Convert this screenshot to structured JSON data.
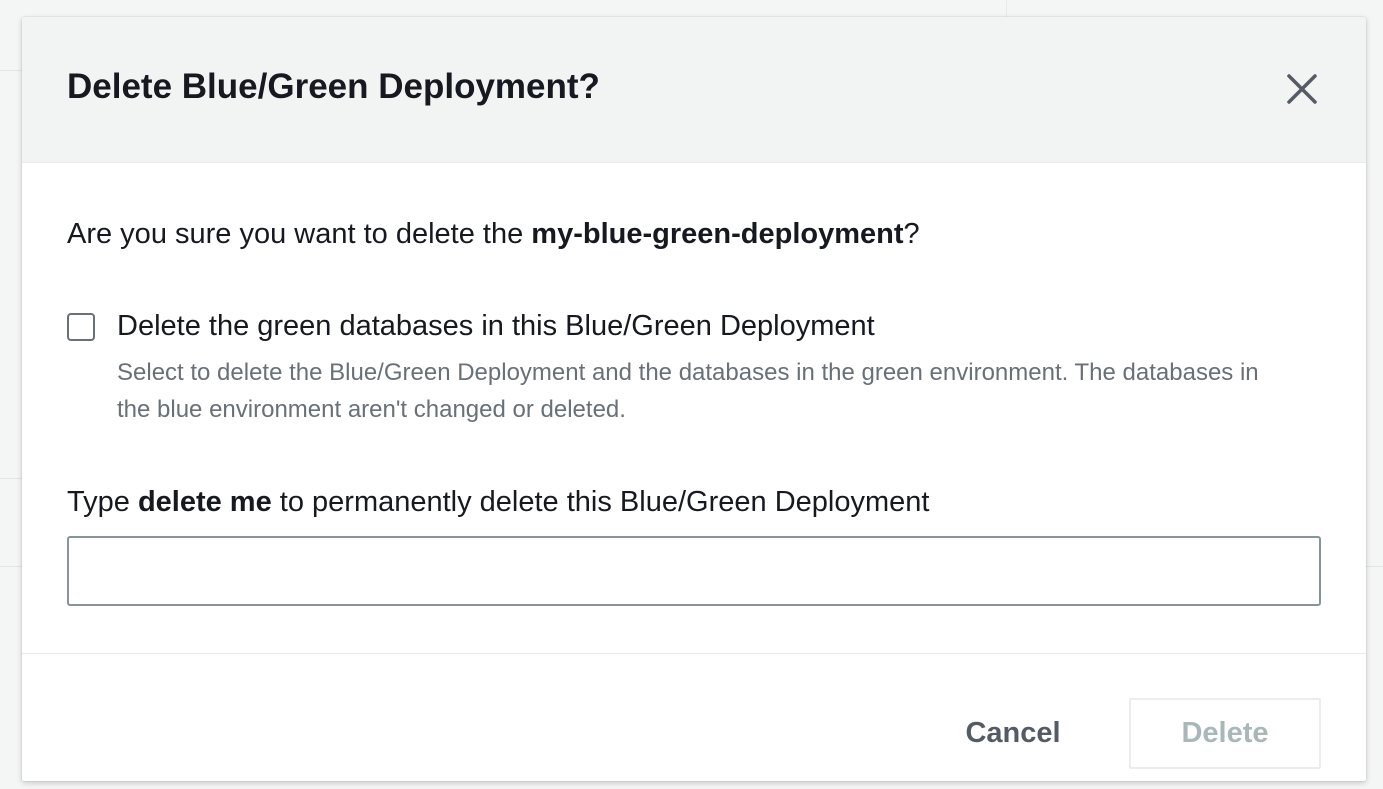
{
  "dialog": {
    "title": "Delete Blue/Green Deployment?",
    "close_icon": "close-icon"
  },
  "body": {
    "question_prefix": "Are you sure you want to delete the ",
    "question_target": "my-blue-green-deployment",
    "question_suffix": "?",
    "checkbox": {
      "label": "Delete the green databases in this Blue/Green Deployment",
      "description": "Select to delete the Blue/Green Deployment and the databases in the green environment. The databases in the blue environment aren't changed or deleted.",
      "checked": false
    },
    "confirm": {
      "prefix": "Type ",
      "keyword": "delete me",
      "suffix": " to permanently delete this Blue/Green Deployment",
      "value": ""
    }
  },
  "footer": {
    "cancel_label": "Cancel",
    "delete_label": "Delete",
    "delete_disabled": true
  },
  "colors": {
    "header_bg": "#f2f3f3",
    "text_primary": "#16191f",
    "text_secondary": "#687078",
    "disabled_text": "#aab7b8"
  }
}
